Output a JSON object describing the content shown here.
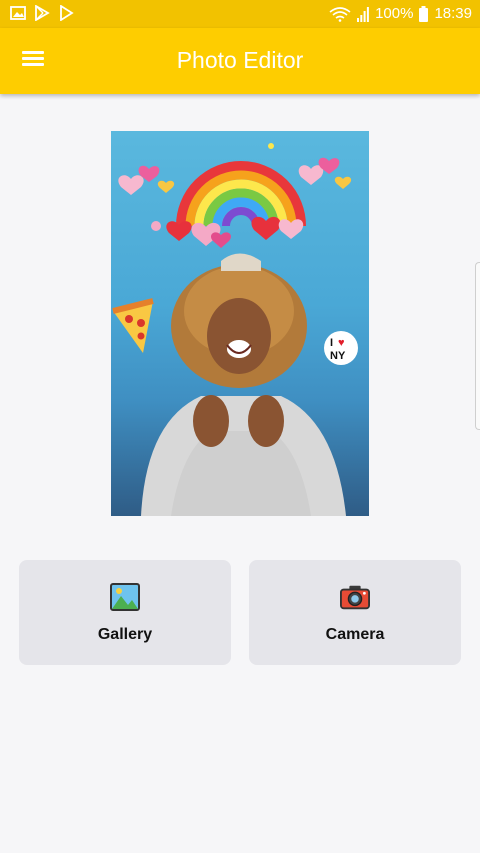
{
  "status_bar": {
    "battery_text": "100%",
    "time": "18:39",
    "left_icons": [
      "image-notification-icon",
      "play-store-icon",
      "play-icon"
    ],
    "right_icons": [
      "wifi-icon",
      "signal-icon",
      "battery-icon"
    ]
  },
  "toolbar": {
    "title": "Photo Editor",
    "menu_icon": "hamburger-menu-icon",
    "background": "#fecd00"
  },
  "preview": {
    "icon": "sample-photo-with-stickers",
    "stickers": [
      "rainbow-sticker",
      "hearts-sticker",
      "pizza-sticker",
      "i-love-ny-sticker"
    ],
    "ny_sticker": {
      "line1": "I",
      "heart": "♥",
      "line2": "NY"
    }
  },
  "actions": {
    "gallery": {
      "label": "Gallery",
      "icon": "gallery-icon"
    },
    "camera": {
      "label": "Camera",
      "icon": "camera-icon"
    }
  }
}
